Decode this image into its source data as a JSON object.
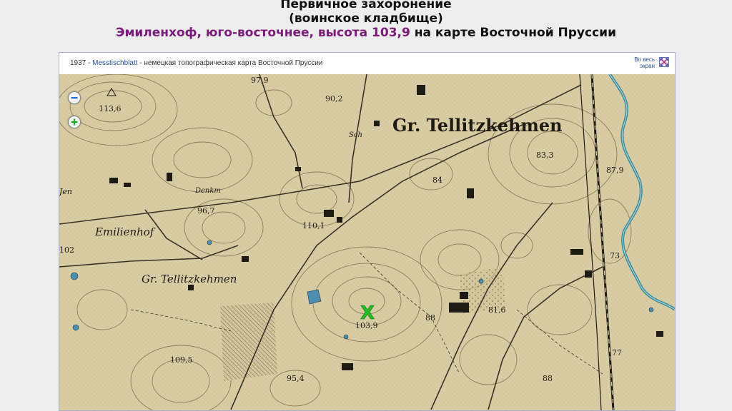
{
  "header": {
    "line1": "Первичное захоронение",
    "line2": "(воинское кладбище)",
    "location": "Эмиленхоф, юго-восточнее, высота 103,9",
    "suffix": " на карте Восточной Пруссии"
  },
  "map_toolbar": {
    "year": "1937 - ",
    "source_link": "Messtischblatt",
    "description": " - немецкая топографическая карта Восточной Пруссии",
    "fullscreen_line1": "Во весь",
    "fullscreen_line2": "экран"
  },
  "map": {
    "labels": {
      "town_main": "Gr. Tellitzkehmen",
      "village_west": "Emilienhof",
      "village_south": "Gr. Tellitzkehmen",
      "schule": "Sch",
      "denkm": "Denkm",
      "jen": "Jen",
      "elev_1136": "113,6",
      "elev_979": "97,9",
      "elev_902": "90,2",
      "elev_833": "83,3",
      "elev_879": "87,9",
      "elev_967": "96,7",
      "elev_1101": "110,1",
      "elev_1039": "103,9",
      "elev_88a": "88",
      "elev_816": "81,6",
      "elev_102": "102",
      "elev_1095": "109,5",
      "elev_954": "95,4",
      "elev_77": "77",
      "elev_88b": "88",
      "elev_73": "73",
      "elev_84": "84"
    },
    "marker": "X",
    "colors": {
      "paper": "#d8cca4",
      "ink": "#2a241c",
      "river": "#3c8c9c",
      "marker": "#22bb22"
    }
  }
}
